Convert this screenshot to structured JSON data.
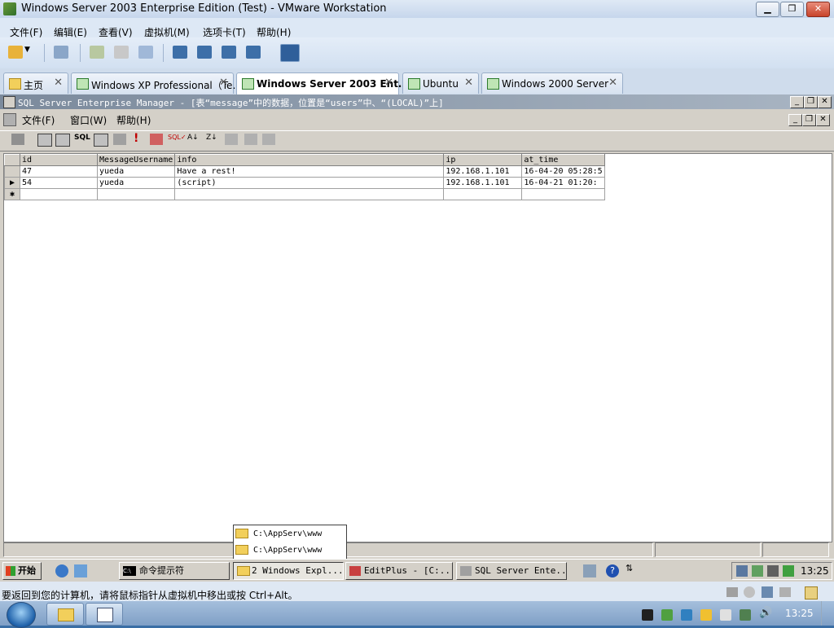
{
  "vmware": {
    "title": "Windows Server 2003 Enterprise Edition (Test) - VMware Workstation",
    "menu": [
      "文件(F)",
      "编辑(E)",
      "查看(V)",
      "虚拟机(M)",
      "选项卡(T)",
      "帮助(H)"
    ],
    "tabs": [
      {
        "label": "主页",
        "active": false
      },
      {
        "label": "Windows XP Professional（Te…",
        "active": false
      },
      {
        "label": "Windows Server 2003 Ent…",
        "active": true
      },
      {
        "label": "Ubuntu",
        "active": false
      },
      {
        "label": "Windows 2000 Server",
        "active": false
      }
    ],
    "status_text": "要返回到您的计算机，请将鼠标指针从虚拟机中移出或按 Ctrl+Alt。"
  },
  "sql": {
    "window_title": "SQL Server Enterprise Manager - [表“message”中的数据，位置是“users”中、“(LOCAL)”上]",
    "menu": [
      "文件(F)",
      "窗口(W)",
      "帮助(H)"
    ],
    "columns": [
      "id",
      "MessageUsername",
      "info",
      "ip",
      "at_time"
    ],
    "rows": [
      [
        "47",
        "yueda",
        "Have a rest!",
        "192.168.1.101",
        "16-04-20 05:28:5"
      ],
      [
        "54",
        "yueda",
        "(script)",
        "192.168.1.101",
        "16-04-21 01:20:"
      ]
    ]
  },
  "guest_taskbar": {
    "start": "开始",
    "items": [
      "命令提示符",
      "2 Windows Expl...",
      "EditPlus - [C:...",
      "SQL Server Ente..."
    ],
    "popup": [
      "C:\\AppServ\\www",
      "C:\\AppServ\\www"
    ],
    "clock": "13:25"
  },
  "host_clock": "13:25"
}
